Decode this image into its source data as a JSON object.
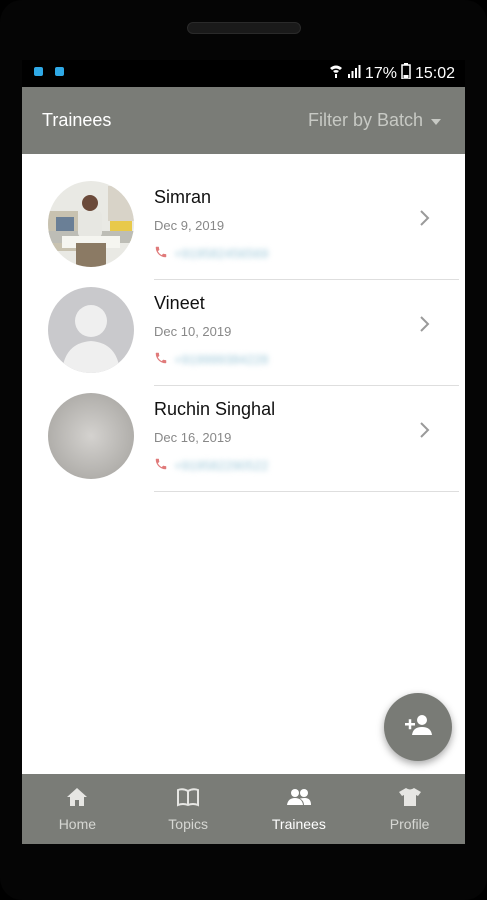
{
  "status_bar": {
    "battery": "17%",
    "time": "15:02"
  },
  "app_bar": {
    "title": "Trainees",
    "filter_label": "Filter by Batch"
  },
  "trainees": [
    {
      "name": "Simran",
      "date": "Dec 9, 2019",
      "phone": "+919582456569",
      "avatar": "photo"
    },
    {
      "name": "Vineet",
      "date": "Dec 10, 2019",
      "phone": "+919999384228",
      "avatar": "placeholder"
    },
    {
      "name": "Ruchin Singhal",
      "date": "Dec 16, 2019",
      "phone": "+919582290522",
      "avatar": "blank"
    }
  ],
  "fab": {
    "icon": "add-person-icon"
  },
  "bottom_nav": [
    {
      "label": "Home",
      "icon": "home-icon",
      "active": false
    },
    {
      "label": "Topics",
      "icon": "book-icon",
      "active": false
    },
    {
      "label": "Trainees",
      "icon": "people-icon",
      "active": true
    },
    {
      "label": "Profile",
      "icon": "shirt-icon",
      "active": false
    }
  ],
  "colors": {
    "appbar": "#7a7c77",
    "accent_phone_icon": "#e07a7a",
    "active_tab": "#ffffff"
  }
}
